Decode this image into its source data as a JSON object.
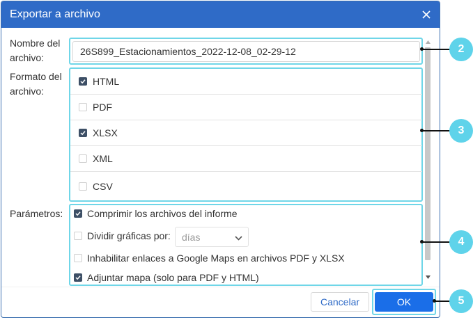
{
  "dialog": {
    "title": "Exportar a archivo",
    "close_icon": "close-icon",
    "title_bar_color": "#2f6bc7"
  },
  "filename": {
    "label": "Nombre del archivo:",
    "value": "26S899_Estacionamientos_2022-12-08_02-29-12"
  },
  "format": {
    "label": "Formato del archivo:",
    "options": [
      {
        "label": "HTML",
        "checked": true
      },
      {
        "label": "PDF",
        "checked": false
      },
      {
        "label": "XLSX",
        "checked": true
      },
      {
        "label": "XML",
        "checked": false
      },
      {
        "label": "CSV",
        "checked": false
      }
    ]
  },
  "params": {
    "label": "Parámetros:",
    "compress": {
      "label": "Comprimir los archivos del informe",
      "checked": true
    },
    "split_charts": {
      "label": "Dividir gráficas por:",
      "checked": false,
      "select_value": "días"
    },
    "disable_links": {
      "label": "Inhabilitar enlaces a Google Maps en archivos PDF y XLSX",
      "checked": false
    },
    "attach_map": {
      "label": "Adjuntar mapa (solo para PDF y HTML)",
      "checked": true
    }
  },
  "buttons": {
    "cancel": "Cancelar",
    "ok": "OK",
    "ok_color": "#1a6ee8"
  },
  "callouts": [
    "2",
    "3",
    "4",
    "5"
  ],
  "highlight_color": "#6fd6e8"
}
